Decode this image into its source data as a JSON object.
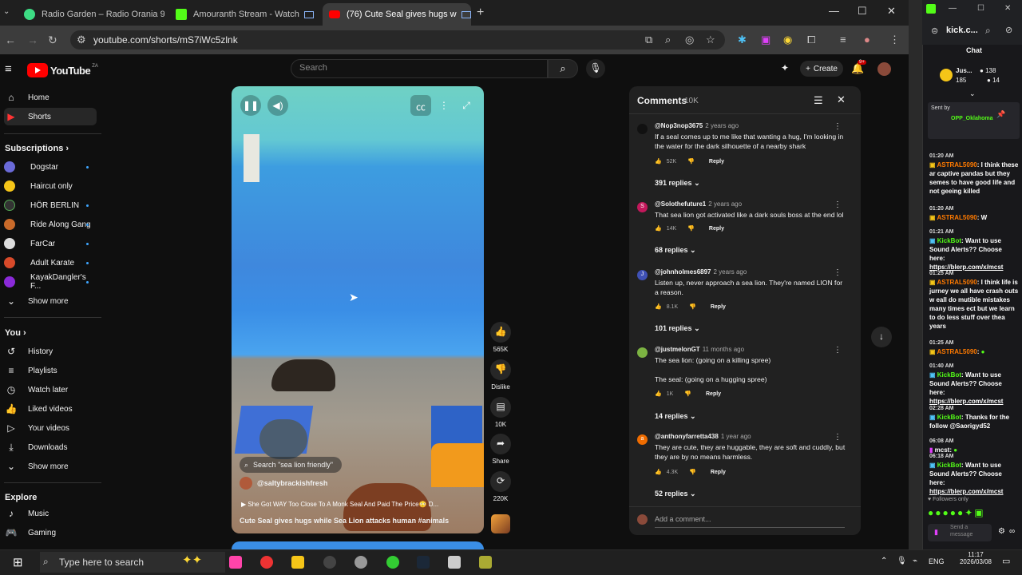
{
  "browser": {
    "tabs": [
      {
        "title": "Radio Garden – Radio Orania 9",
        "color": "#3ddc84"
      },
      {
        "title": "Amouranth Stream - Watch",
        "color": "#53fc18"
      },
      {
        "title": "(76) Cute Seal gives hugs w",
        "color": "#ff0000"
      }
    ],
    "url": "youtube.com/shorts/mS7iWc5zlnk"
  },
  "youtube": {
    "logo": "YouTube",
    "country": "ZA",
    "search_placeholder": "Search",
    "create_label": "Create",
    "notif_count": "9+",
    "nav": [
      {
        "label": "Home",
        "icon": "home-icon",
        "glyph": "⌂"
      },
      {
        "label": "Shorts",
        "icon": "shorts-icon",
        "glyph": "▶"
      }
    ],
    "subscriptions_header": "Subscriptions",
    "subscriptions": [
      {
        "label": "Dogstar",
        "color": "#6a6ad8"
      },
      {
        "label": "Haircut only",
        "color": "#f5c518"
      },
      {
        "label": "HÖR BERLIN",
        "color": "#222"
      },
      {
        "label": "Ride Along Gang",
        "color": "#c96a2a"
      },
      {
        "label": "FarCar",
        "color": "#ddd"
      },
      {
        "label": "Adult Karate",
        "color": "#d84a2a"
      },
      {
        "label": "KayakDangler's F...",
        "color": "#8a2ad8"
      }
    ],
    "show_more": "Show more",
    "you_header": "You",
    "you_items": [
      {
        "label": "History",
        "glyph": "↺"
      },
      {
        "label": "Playlists",
        "glyph": "≡"
      },
      {
        "label": "Watch later",
        "glyph": "◷"
      },
      {
        "label": "Liked videos",
        "glyph": "👍"
      },
      {
        "label": "Your videos",
        "glyph": "▷"
      },
      {
        "label": "Downloads",
        "glyph": "⤓"
      },
      {
        "label": "Show more",
        "glyph": "⌄"
      }
    ],
    "explore_header": "Explore",
    "explore_items": [
      {
        "label": "Music",
        "glyph": "♪"
      },
      {
        "label": "Gaming",
        "glyph": "🎮"
      }
    ]
  },
  "video": {
    "search_chip": "Search \"sea lion friendly\"",
    "channel": "@saltybrackishfresh",
    "related": "She Got WAY Too Close To A Monk Seal And Paid The Price😳 D...",
    "title": "Cute Seal gives hugs while Sea Lion attacks human #animals",
    "likes": "565K",
    "dislike": "Dislike",
    "comments": "10K",
    "share": "Share",
    "remix": "220K"
  },
  "comments_panel": {
    "title": "Comments",
    "count": "10K",
    "add_placeholder": "Add a comment...",
    "items": [
      {
        "user": "@Nop3nop3675",
        "time": "2 years ago",
        "text": "If a seal comes up to me like that wanting a hug, I'm looking in the water for the dark silhouette of a nearby shark",
        "likes": "52K",
        "replies": "391 replies",
        "avatar": "",
        "color": "#111"
      },
      {
        "user": "@Solothefuture1",
        "time": "2 years ago",
        "text": "That sea lion got activated like a dark souls boss at the end lol",
        "likes": "14K",
        "replies": "68 replies",
        "avatar": "S",
        "color": "#c2185b"
      },
      {
        "user": "@johnholmes6897",
        "time": "2 years ago",
        "text": "Listen up,  never approach a sea lion.  They're named LION for a reason.",
        "likes": "8.1K",
        "replies": "101 replies",
        "avatar": "J",
        "color": "#3f51b5"
      },
      {
        "user": "@justmelonGT",
        "time": "11 months ago",
        "text": "The sea lion: (going on a killing spree)\n\nThe seal: (going on a hugging spree)",
        "likes": "1K",
        "replies": "14 replies",
        "avatar": "",
        "color": "#7cb342"
      },
      {
        "user": "@anthonyfarretta438",
        "time": "1 year ago",
        "text": "They are cute, they are huggable,  they are soft and cuddly,  but they are by no means harmless.",
        "likes": "4.3K",
        "replies": "52 replies",
        "avatar": "a",
        "color": "#ef6c00"
      }
    ],
    "reply_label": "Reply"
  },
  "kick": {
    "title": "kick.c...",
    "chat_label": "Chat",
    "header_user": "Jus...",
    "header_stats": [
      "138",
      "185",
      "14"
    ],
    "pinned_label": "Sent by",
    "pinned_user": "OPP_Oklahoma",
    "messages": [
      {
        "time": "01:20 AM",
        "user": "ASTRAL5090",
        "text": "I think these ar captive pandas but they semes to have good life and not geeing killed"
      },
      {
        "time": "01:20 AM",
        "user": "ASTRAL5090",
        "text": "W"
      },
      {
        "time": "01:21 AM",
        "user": "KickBot",
        "text": "Want to use Sound Alerts?? Choose here:",
        "link": "https://blerp.com/x/mcst"
      },
      {
        "time": "01:25 AM",
        "user": "ASTRAL5090",
        "text": "I think life is jurney we all have crash outs w eall do mutible mistakes many times ect but we learn to do less stuff over thea years"
      },
      {
        "time": "01:25 AM",
        "user": "ASTRAL5090",
        "text": ""
      },
      {
        "time": "01:40 AM",
        "user": "KickBot",
        "text": "Want to use Sound Alerts?? Choose here:",
        "link": "https://blerp.com/x/mcst"
      },
      {
        "time": "02:28 AM",
        "user": "KickBot",
        "text": "Thanks for the follow @Saorigyd52"
      },
      {
        "time": "06:08 AM",
        "user": "mcst",
        "text": ""
      },
      {
        "time": "06:18 AM",
        "user": "KickBot",
        "text": "Want to use Sound Alerts?? Choose here:",
        "link": "https://blerp.com/x/mcst"
      }
    ],
    "followers_only": "Followers only",
    "send_placeholder": "Send a message"
  },
  "taskbar": {
    "search": "Type here to search",
    "lang": "ENG",
    "time": "11:17",
    "date": "2026/03/08"
  }
}
